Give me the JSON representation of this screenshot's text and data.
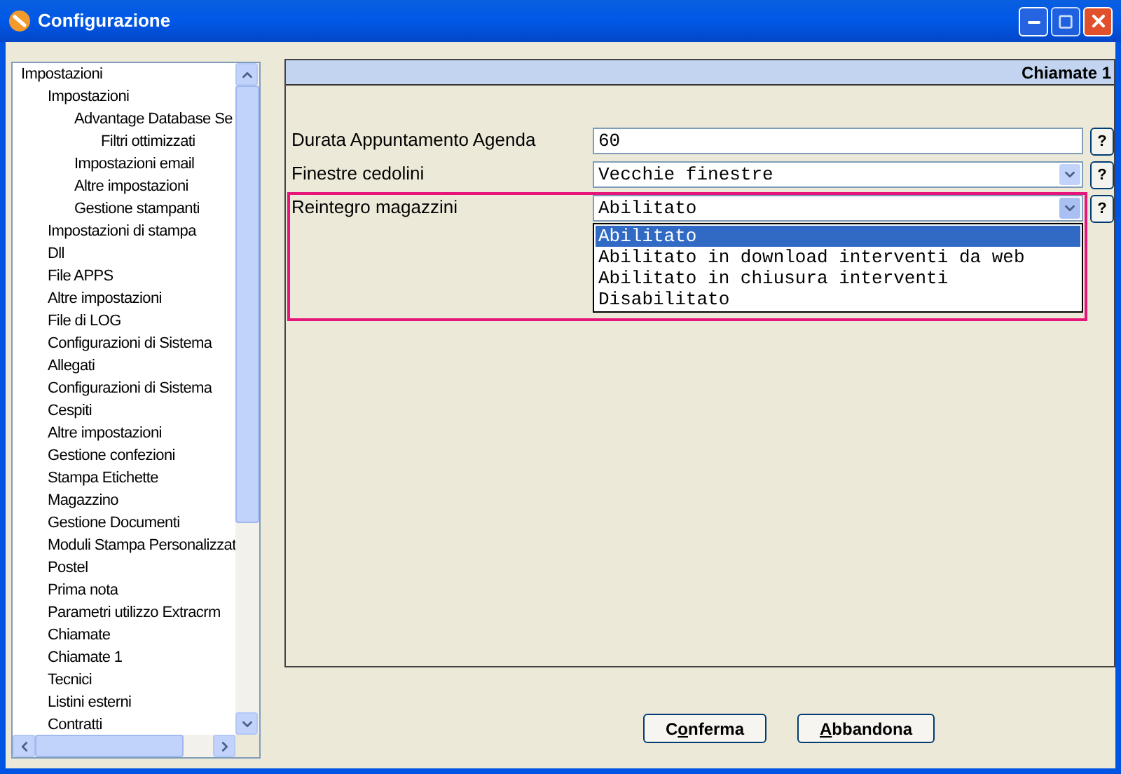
{
  "window": {
    "title": "Configurazione"
  },
  "tree": [
    {
      "label": "Impostazioni",
      "children": [
        {
          "label": "Impostazioni",
          "children": [
            {
              "label": "Advantage Database Se",
              "children": [
                {
                  "label": "Filtri ottimizzati"
                }
              ]
            },
            {
              "label": "Impostazioni email"
            },
            {
              "label": "Altre impostazioni"
            },
            {
              "label": "Gestione stampanti"
            }
          ]
        },
        {
          "label": "Impostazioni di stampa"
        },
        {
          "label": "Dll"
        },
        {
          "label": "File APPS"
        },
        {
          "label": "Altre impostazioni"
        },
        {
          "label": "File di LOG"
        },
        {
          "label": "Configurazioni di Sistema"
        },
        {
          "label": "Allegati"
        },
        {
          "label": "Configurazioni di Sistema"
        },
        {
          "label": "Cespiti"
        },
        {
          "label": "Altre impostazioni"
        },
        {
          "label": "Gestione confezioni"
        },
        {
          "label": "Stampa Etichette"
        },
        {
          "label": "Magazzino"
        },
        {
          "label": "Gestione Documenti"
        },
        {
          "label": "Moduli Stampa Personalizzat"
        },
        {
          "label": "Postel"
        },
        {
          "label": "Prima nota"
        },
        {
          "label": "Parametri utilizzo Extracrm"
        },
        {
          "label": "Chiamate"
        },
        {
          "label": "Chiamate 1"
        },
        {
          "label": "Tecnici"
        },
        {
          "label": "Listini esterni"
        },
        {
          "label": "Contratti"
        }
      ]
    }
  ],
  "panel": {
    "title": "Chiamate 1"
  },
  "fields": [
    {
      "kind": "text",
      "label": "Durata Appuntamento Agenda",
      "value": "60",
      "help": "?",
      "highlighted": false
    },
    {
      "kind": "select",
      "label": "Finestre cedolini",
      "value": "Vecchie finestre",
      "help": "?",
      "highlighted": false,
      "expanded": false
    },
    {
      "kind": "select",
      "label": "Reintegro magazzini",
      "value": "Abilitato",
      "help": "?",
      "highlighted": true,
      "expanded": true,
      "options": [
        {
          "label": "Abilitato",
          "selected": true
        },
        {
          "label": "Abilitato in download interventi da web",
          "selected": false
        },
        {
          "label": "Abilitato in chiusura interventi",
          "selected": false
        },
        {
          "label": "Disabilitato",
          "selected": false
        }
      ]
    }
  ],
  "buttons": [
    {
      "before": "C",
      "key": "o",
      "after": "nferma"
    },
    {
      "key": "A",
      "after": "bbandona"
    }
  ]
}
